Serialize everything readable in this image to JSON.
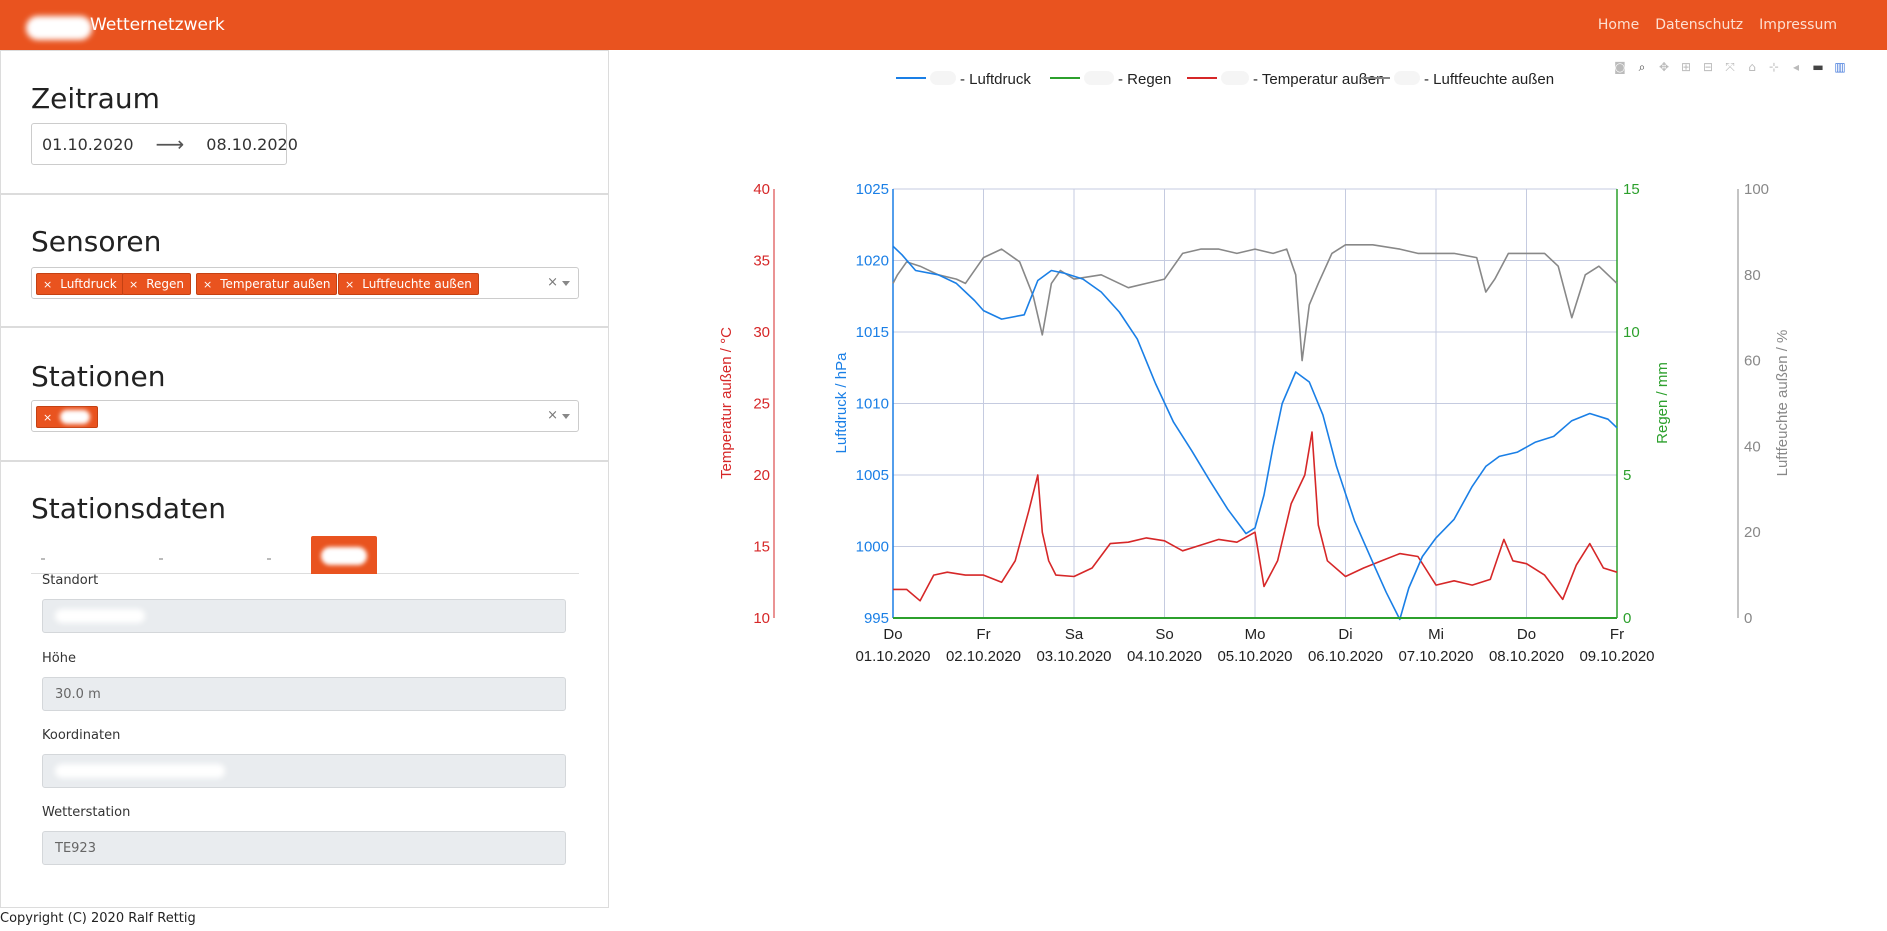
{
  "navbar": {
    "brand": "Wetternetzwerk",
    "links": [
      "Home",
      "Datenschutz",
      "Impressum"
    ]
  },
  "zeitraum": {
    "title": "Zeitraum",
    "start": "01.10.2020",
    "arrow": "⟶",
    "end": "08.10.2020"
  },
  "sensoren": {
    "title": "Sensoren",
    "tags": [
      "Luftdruck",
      "Regen",
      "Temperatur außen",
      "Luftfeuchte außen"
    ],
    "tag_remove": "×",
    "clear": "×"
  },
  "stationen": {
    "title": "Stationen",
    "tag_remove": "×",
    "clear": "×"
  },
  "stationsdaten": {
    "title": "Stationsdaten",
    "fields": [
      {
        "label": "Standort",
        "value": ""
      },
      {
        "label": "Höhe",
        "value": "30.0 m"
      },
      {
        "label": "Koordinaten",
        "value": ""
      },
      {
        "label": "Wetterstation",
        "value": "TE923"
      }
    ]
  },
  "footer": "Copyright (C) 2020 Ralf Rettig",
  "modebar_icons": [
    "camera-icon",
    "zoom-icon",
    "pan-icon",
    "zoom-in-icon",
    "zoom-out-icon",
    "autoscale-icon",
    "home-icon",
    "spike-icon",
    "hover-closest-icon",
    "hover-compare-icon",
    "plotly-logo-icon"
  ],
  "chart_data": {
    "type": "line",
    "legend": [
      {
        "name": "- Luftdruck",
        "color": "#1a7fe6"
      },
      {
        "name": "- Regen",
        "color": "#2ca02c"
      },
      {
        "name": "- Temperatur außen",
        "color": "#d62728"
      },
      {
        "name": "- Luftfeuchte außen",
        "color": "#888888"
      }
    ],
    "legend_position": "top",
    "x_ticks": [
      {
        "day": "Do",
        "date": "01.10.2020"
      },
      {
        "day": "Fr",
        "date": "02.10.2020"
      },
      {
        "day": "Sa",
        "date": "03.10.2020"
      },
      {
        "day": "So",
        "date": "04.10.2020"
      },
      {
        "day": "Mo",
        "date": "05.10.2020"
      },
      {
        "day": "Di",
        "date": "06.10.2020"
      },
      {
        "day": "Mi",
        "date": "07.10.2020"
      },
      {
        "day": "Do",
        "date": "08.10.2020"
      },
      {
        "day": "Fr",
        "date": "09.10.2020"
      }
    ],
    "x_range_days": [
      0,
      8
    ],
    "axes": {
      "temperature": {
        "label": "Temperatur außen / °C",
        "range": [
          10,
          40
        ],
        "ticks": [
          10,
          15,
          20,
          25,
          30,
          35,
          40
        ],
        "color": "#d62728"
      },
      "pressure": {
        "label": "Luftdruck / hPa",
        "range": [
          995,
          1025
        ],
        "ticks": [
          995,
          1000,
          1005,
          1010,
          1015,
          1020,
          1025
        ],
        "color": "#1a7fe6"
      },
      "rain": {
        "label": "Regen / mm",
        "range": [
          0,
          15
        ],
        "ticks": [
          0,
          5,
          10,
          15
        ],
        "color": "#2ca02c"
      },
      "humidity": {
        "label": "Luftfeuchte außen / %",
        "range": [
          0,
          100
        ],
        "ticks": [
          0,
          20,
          40,
          60,
          80,
          100
        ],
        "color": "#888888"
      }
    },
    "grid": true,
    "series": [
      {
        "name": "Luftdruck",
        "axis": "pressure",
        "color": "#1a7fe6",
        "x": [
          0,
          0.1,
          0.25,
          0.5,
          0.7,
          0.9,
          1.0,
          1.2,
          1.45,
          1.6,
          1.75,
          1.9,
          2.1,
          2.3,
          2.5,
          2.7,
          2.9,
          3.1,
          3.3,
          3.5,
          3.7,
          3.9,
          4.0,
          4.1,
          4.2,
          4.3,
          4.45,
          4.6,
          4.75,
          4.9,
          5.1,
          5.3,
          5.45,
          5.6,
          5.7,
          5.85,
          6.0,
          6.2,
          6.4,
          6.55,
          6.7,
          6.9,
          7.1,
          7.3,
          7.5,
          7.7,
          7.9,
          8.0
        ],
        "y": [
          1021.0,
          1020.4,
          1019.3,
          1019.0,
          1018.4,
          1017.2,
          1016.5,
          1015.9,
          1016.2,
          1018.6,
          1019.3,
          1019.1,
          1018.7,
          1017.8,
          1016.4,
          1014.5,
          1011.4,
          1008.7,
          1006.7,
          1004.6,
          1002.6,
          1000.9,
          1001.3,
          1003.6,
          1007.0,
          1010.0,
          1012.2,
          1011.5,
          1009.2,
          1005.6,
          1001.8,
          998.9,
          996.8,
          994.9,
          997.1,
          999.3,
          1000.6,
          1001.9,
          1004.2,
          1005.6,
          1006.3,
          1006.6,
          1007.3,
          1007.7,
          1008.8,
          1009.3,
          1008.9,
          1008.3
        ]
      },
      {
        "name": "Regen",
        "axis": "rain",
        "color": "#2ca02c",
        "x": [
          0,
          8
        ],
        "y": [
          0,
          0
        ]
      },
      {
        "name": "Temperatur außen",
        "axis": "temperature",
        "color": "#d62728",
        "x": [
          0,
          0.15,
          0.3,
          0.45,
          0.6,
          0.8,
          1.0,
          1.2,
          1.35,
          1.5,
          1.6,
          1.65,
          1.72,
          1.8,
          2.0,
          2.2,
          2.4,
          2.6,
          2.8,
          3.0,
          3.2,
          3.4,
          3.6,
          3.8,
          4.0,
          4.1,
          4.25,
          4.4,
          4.55,
          4.63,
          4.7,
          4.8,
          5.0,
          5.2,
          5.4,
          5.6,
          5.8,
          6.0,
          6.2,
          6.4,
          6.6,
          6.75,
          6.85,
          7.0,
          7.2,
          7.4,
          7.55,
          7.7,
          7.85,
          8.0
        ],
        "y": [
          12.0,
          12.0,
          11.2,
          13.0,
          13.2,
          13.0,
          13.0,
          12.5,
          14.0,
          17.5,
          20.0,
          16.0,
          14.0,
          13.0,
          12.9,
          13.5,
          15.2,
          15.3,
          15.6,
          15.4,
          14.7,
          15.1,
          15.5,
          15.3,
          16.0,
          12.2,
          14.0,
          18.0,
          20.0,
          23.0,
          16.5,
          14.0,
          12.9,
          13.5,
          14.0,
          14.5,
          14.3,
          12.3,
          12.6,
          12.3,
          12.7,
          15.5,
          14.0,
          13.8,
          13.0,
          11.3,
          13.7,
          15.2,
          13.5,
          13.2
        ]
      },
      {
        "name": "Luftfeuchte außen",
        "axis": "humidity",
        "color": "#888888",
        "x": [
          0,
          0.05,
          0.15,
          0.3,
          0.5,
          0.7,
          0.8,
          1.0,
          1.2,
          1.4,
          1.55,
          1.65,
          1.75,
          1.85,
          2.0,
          2.3,
          2.6,
          2.8,
          3.0,
          3.2,
          3.4,
          3.6,
          3.8,
          4.0,
          4.2,
          4.35,
          4.45,
          4.52,
          4.6,
          4.7,
          4.85,
          5.0,
          5.3,
          5.6,
          5.8,
          6.0,
          6.2,
          6.45,
          6.55,
          6.65,
          6.8,
          7.0,
          7.2,
          7.35,
          7.5,
          7.65,
          7.8,
          8.0
        ],
        "y": [
          78,
          80,
          83,
          82,
          80,
          79,
          78,
          84,
          86,
          83,
          75,
          66,
          78,
          81,
          79,
          80,
          77,
          78,
          79,
          85,
          86,
          86,
          85,
          86,
          85,
          86,
          80,
          60,
          73,
          78,
          85,
          87,
          87,
          86,
          85,
          85,
          85,
          84,
          76,
          79,
          85,
          85,
          85,
          82,
          70,
          80,
          82,
          78
        ]
      }
    ]
  }
}
